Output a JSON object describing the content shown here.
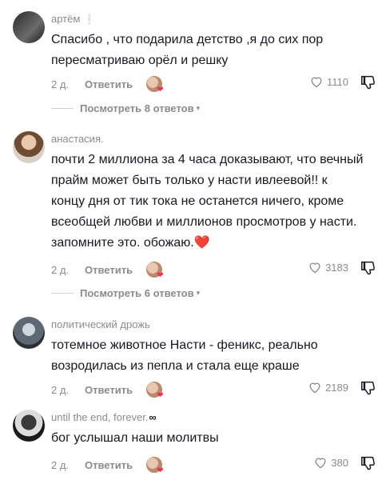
{
  "comments": [
    {
      "username": "артём",
      "username_badge": "❕",
      "text": "Спасибо , что подарила детство ,я до сих пор пересматриваю орёл и решку",
      "time": "2 д.",
      "reply_label": "Ответить",
      "likes": "1110",
      "view_replies": "Посмотреть 8 ответов"
    },
    {
      "username": "анастасия.",
      "text": "почти 2 миллиона за 4 часа доказывают, что вечный прайм может быть только у насти ивлеевой!! к концу дня от тик тока не останется ничего, кроме всеобщей любви и миллионов просмотров у насти. запомните это. обожаю.",
      "text_emoji": "❤️",
      "time": "2 д.",
      "reply_label": "Ответить",
      "likes": "3183",
      "view_replies": "Посмотреть 6 ответов"
    },
    {
      "username": "политический дрожь",
      "text": "тотемное животное Насти - феникс, реально возродилась из пепла и стала еще краше",
      "time": "2 д.",
      "reply_label": "Ответить",
      "likes": "2189"
    },
    {
      "username": "until the end, forever.",
      "username_suffix": "∞",
      "text": "бог услышал наши молитвы",
      "time": "2 д.",
      "reply_label": "Ответить",
      "likes": "380"
    }
  ],
  "colors": {
    "text": "#161823",
    "muted": "#8a8b91",
    "accent": "#fe2c55"
  },
  "icons": [
    "heart-outline-icon",
    "dislike-icon",
    "chevron-down-icon",
    "creator-liked-avatar"
  ]
}
